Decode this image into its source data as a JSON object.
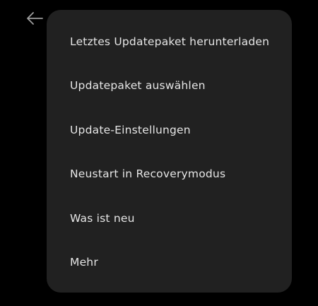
{
  "nav": {
    "back_icon": "arrow-left-icon"
  },
  "colors": {
    "background": "#000000",
    "menu_background": "#212121",
    "text": "#e6e6e6",
    "icon": "#9e9e9e"
  },
  "menu": {
    "items": [
      {
        "label": "Letztes Updatepaket herunterladen"
      },
      {
        "label": "Updatepaket auswählen"
      },
      {
        "label": "Update-Einstellungen"
      },
      {
        "label": "Neustart in Recoverymodus"
      },
      {
        "label": "Was ist neu"
      },
      {
        "label": "Mehr"
      }
    ]
  }
}
